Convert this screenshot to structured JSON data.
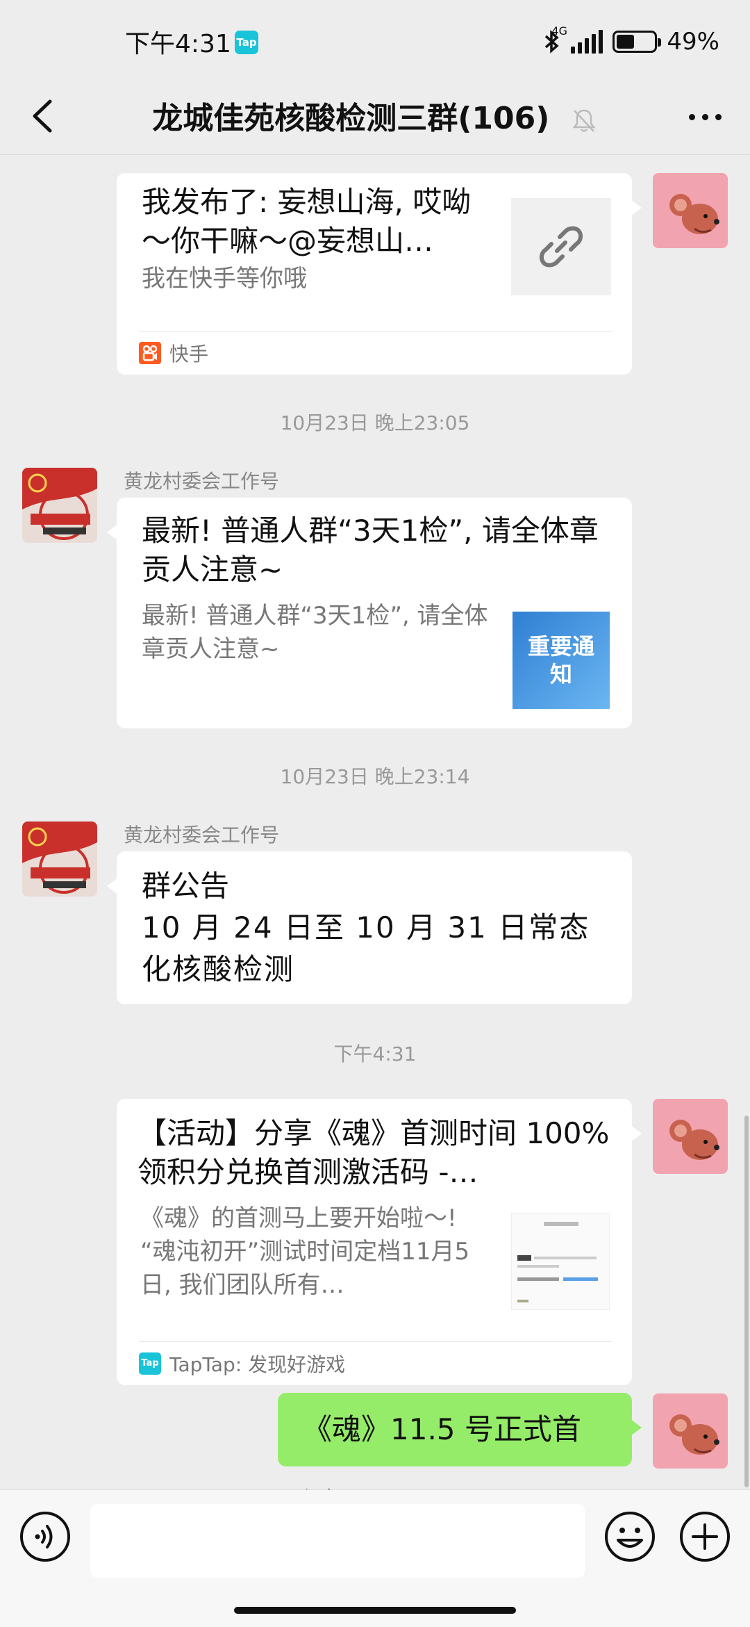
{
  "status_bar": {
    "time": "下午4:31",
    "tap_badge": "Tap",
    "network": "4G",
    "battery": "49%",
    "battery_level": 0.49
  },
  "header": {
    "title": "龙城佳苑核酸检测三群(106)",
    "back_icon": "chevron-left-icon",
    "mute_icon": "bell-off-icon",
    "more_icon": "more-dots-icon"
  },
  "messages": {
    "m1": {
      "title": "我发布了: 妄想山海, 哎呦～你干嘛～@妄想山…",
      "desc": "我在快手等你哦",
      "source": "快手",
      "thumb_icon": "link-icon"
    },
    "t1": "10月23日 晚上23:05",
    "m2": {
      "sender": "黄龙村委会工作号",
      "title": "最新! 普通人群“3天1检”, 请全体章贡人注意~",
      "desc": "最新! 普通人群“3天1检”, 请全体章贡人注意~",
      "thumb_text": "重要通知"
    },
    "t2": "10月23日 晚上23:14",
    "m3": {
      "sender": "黄龙村委会工作号",
      "line1": "群公告",
      "line2": "10 月 24 日至 10 月 31 日常态化核酸检测"
    },
    "t3": "下午4:31",
    "m4": {
      "title": "【活动】分享《魂》首测时间 100%领积分兑换首测激活码 -…",
      "desc": "《魂》的首测马上要开始啦～! “魂沌初开”测试时间定档11月5日, 我们团队所有…",
      "source": "TapTap: 发现好游戏",
      "source_badge": "Tap"
    },
    "m5": {
      "text": "《魂》11.5 号正式首测"
    }
  },
  "input_bar": {
    "voice_icon": "voice-icon",
    "emoji_icon": "emoji-icon",
    "plus_icon": "plus-circle-icon",
    "value": ""
  },
  "colors": {
    "background": "#ededed",
    "bubble_green": "#95ec69",
    "taptap": "#19c4d9",
    "kuaishou": "#ff5a1f"
  }
}
